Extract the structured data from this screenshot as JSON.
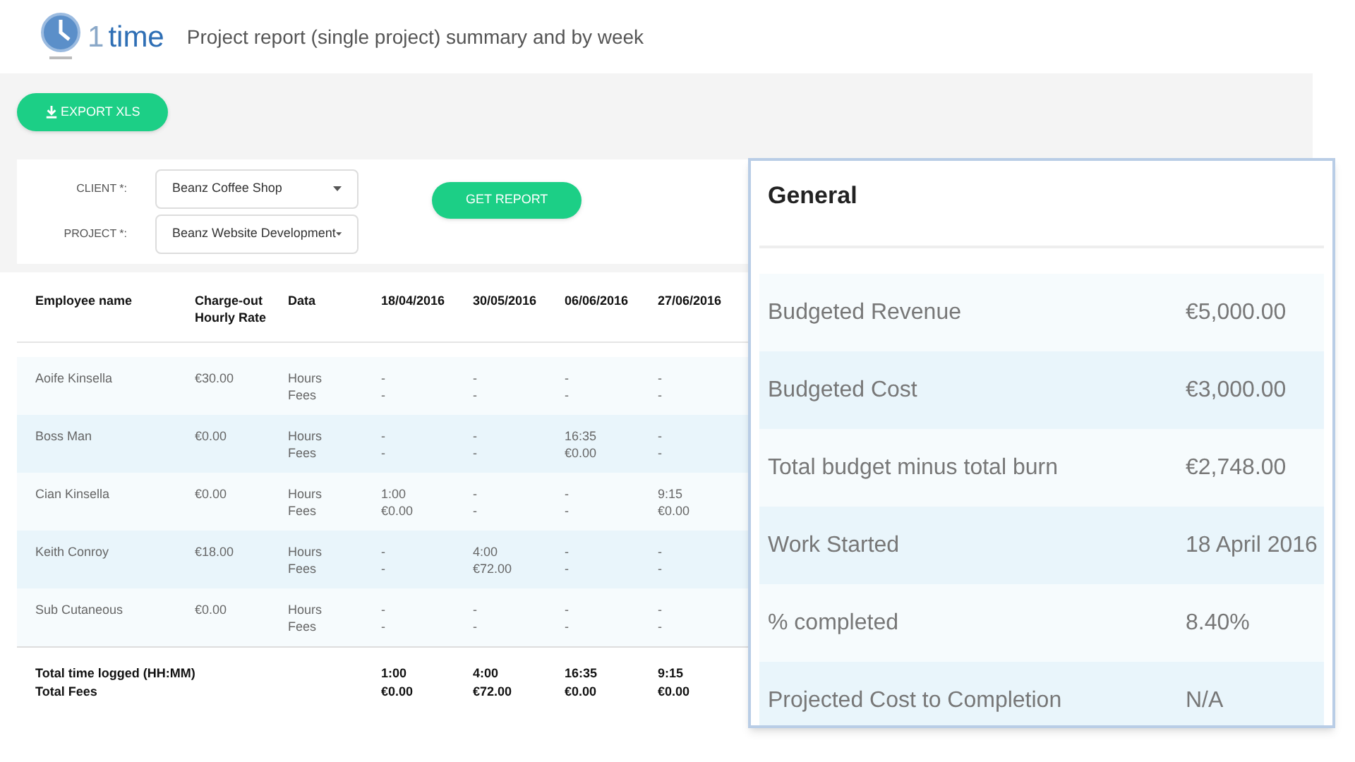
{
  "header": {
    "logo_text": "time",
    "logo_digit": "1",
    "title": "Project report (single project) summary and by week"
  },
  "export_button": "EXPORT XLS",
  "form": {
    "fields": [
      {
        "label": "CLIENT *:",
        "value": "Beanz Coffee Shop"
      },
      {
        "label": "PROJECT *:",
        "value": "Beanz Website Development"
      }
    ],
    "button": "GET REPORT"
  },
  "table": {
    "columns": [
      "Employee name",
      "Charge-out Hourly Rate",
      "Data",
      "18/04/2016",
      "30/05/2016",
      "06/06/2016",
      "27/06/2016"
    ],
    "rows": [
      {
        "name": "Aoife Kinsella",
        "rate": "€30.00",
        "data": [
          "Hours",
          "Fees"
        ],
        "weeks": [
          [
            "-",
            "-"
          ],
          [
            "-",
            "-"
          ],
          [
            "-",
            "-"
          ],
          [
            "-",
            "-"
          ]
        ]
      },
      {
        "name": "Boss Man",
        "rate": "€0.00",
        "data": [
          "Hours",
          "Fees"
        ],
        "weeks": [
          [
            "-",
            "-"
          ],
          [
            "-",
            "-"
          ],
          [
            "16:35",
            "€0.00"
          ],
          [
            "-",
            "-"
          ]
        ]
      },
      {
        "name": "Cian Kinsella",
        "rate": "€0.00",
        "data": [
          "Hours",
          "Fees"
        ],
        "weeks": [
          [
            "1:00",
            "€0.00"
          ],
          [
            "-",
            "-"
          ],
          [
            "-",
            "-"
          ],
          [
            "9:15",
            "€0.00"
          ]
        ]
      },
      {
        "name": "Keith Conroy",
        "rate": "€18.00",
        "data": [
          "Hours",
          "Fees"
        ],
        "weeks": [
          [
            "-",
            "-"
          ],
          [
            "4:00",
            "€72.00"
          ],
          [
            "-",
            "-"
          ],
          [
            "-",
            "-"
          ]
        ]
      },
      {
        "name": "Sub Cutaneous",
        "rate": "€0.00",
        "data": [
          "Hours",
          "Fees"
        ],
        "weeks": [
          [
            "-",
            "-"
          ],
          [
            "-",
            "-"
          ],
          [
            "-",
            "-"
          ],
          [
            "-",
            "-"
          ]
        ]
      }
    ],
    "totals": {
      "labels": [
        "Total time logged (HH:MM)",
        "Total Fees"
      ],
      "weeks": [
        [
          "1:00",
          "€0.00"
        ],
        [
          "4:00",
          "€72.00"
        ],
        [
          "16:35",
          "€0.00"
        ],
        [
          "9:15",
          "€0.00"
        ]
      ]
    }
  },
  "general": {
    "title": "General",
    "rows": [
      {
        "label": "Budgeted Revenue",
        "value": "€5,000.00"
      },
      {
        "label": "Budgeted Cost",
        "value": "€3,000.00"
      },
      {
        "label": "Total budget minus total burn",
        "value": "€2,748.00"
      },
      {
        "label": "Work Started",
        "value": "18 April 2016"
      },
      {
        "label": "% completed",
        "value": "8.40%"
      },
      {
        "label": "Projected Cost to Completion",
        "value": "N/A"
      }
    ]
  }
}
